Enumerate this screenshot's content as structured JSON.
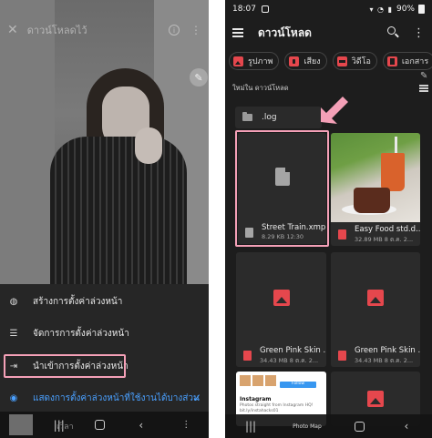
{
  "left_phone": {
    "topbar_title": "ดาวน์โหลดไว้",
    "menu": [
      {
        "label": "สร้างการตั้งค่าล่วงหน้า",
        "icon": "palette-add-icon"
      },
      {
        "label": "จัดการการตั้งค่าล่วงหน้า",
        "icon": "list-manage-icon"
      },
      {
        "label": "นำเข้าการตั้งค่าล่วงหน้า",
        "icon": "import-icon"
      },
      {
        "label": "แสดงการตั้งค่าล่วงหน้าที่ใช้งานได้บางส่วน",
        "icon": "eye-icon"
      }
    ],
    "nav_label": "เวิลา"
  },
  "right_phone": {
    "status": {
      "time": "18:07",
      "battery": "90%"
    },
    "app_title": "ดาวน์โหลด",
    "chips": [
      {
        "label": "รูปภาพ",
        "icon": "image-icon"
      },
      {
        "label": "เสียง",
        "icon": "audio-icon"
      },
      {
        "label": "วิดีโอ",
        "icon": "video-icon"
      },
      {
        "label": "เอกสาร",
        "icon": "document-icon"
      }
    ],
    "section_label": "ใหม่ใน ดาวน์โหลด",
    "folder_name": ".log",
    "files": [
      {
        "name": "Street Train.xmp",
        "meta": "8.29 KB 12:30",
        "type": "document"
      },
      {
        "name": "Easy Food std.d...",
        "meta": "32.89 MB 8 ต.ค. 2...",
        "type": "image"
      },
      {
        "name": "Green Pink Skin ...",
        "meta": "34.43 MB 8 ต.ค. 2...",
        "type": "image"
      },
      {
        "name": "Green Pink Skin ...",
        "meta": "34.43 MB 8 ต.ค. 2...",
        "type": "image"
      }
    ],
    "ig_preview": {
      "title": "Instagram",
      "line1": "Photos straight from Instagram HQ!",
      "line2": "bit.ly/instahacks01",
      "follow": "Follow",
      "tab_label": "Photo Map"
    }
  },
  "colors": {
    "accent_pink": "#f4a0b7",
    "accent_blue": "#4aa0ff",
    "chip_red": "#e5474d"
  }
}
